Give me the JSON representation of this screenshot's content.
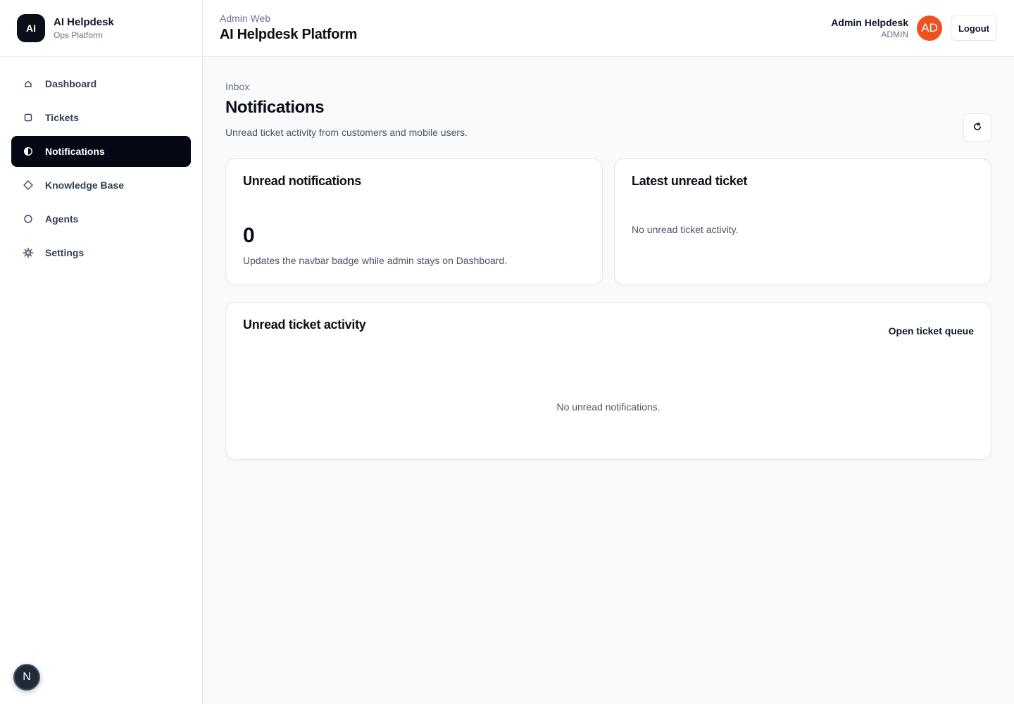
{
  "brand": {
    "logo": "AI",
    "name": "AI Helpdesk",
    "subtitle": "Ops Platform"
  },
  "sidebar": {
    "items": [
      {
        "label": "Dashboard",
        "icon": "home-icon"
      },
      {
        "label": "Tickets",
        "icon": "square-icon"
      },
      {
        "label": "Notifications",
        "icon": "half-circle-icon",
        "active": true
      },
      {
        "label": "Knowledge Base",
        "icon": "diamond-icon"
      },
      {
        "label": "Agents",
        "icon": "circle-icon"
      },
      {
        "label": "Settings",
        "icon": "gear-icon"
      }
    ]
  },
  "header": {
    "eyebrow": "Admin Web",
    "title": "AI Helpdesk Platform",
    "user_name": "Admin Helpdesk",
    "user_role": "ADMIN",
    "avatar_initials": "AD",
    "logout_label": "Logout"
  },
  "page": {
    "eyebrow": "Inbox",
    "title": "Notifications",
    "description": "Unread ticket activity from customers and mobile users."
  },
  "cards": {
    "unread": {
      "title": "Unread notifications",
      "count": "0",
      "note": "Updates the navbar badge while admin stays on Dashboard."
    },
    "latest": {
      "title": "Latest unread ticket",
      "empty": "No unread ticket activity."
    },
    "activity": {
      "title": "Unread ticket activity",
      "link": "Open ticket queue",
      "empty": "No unread notifications."
    }
  },
  "fab": {
    "label": "N"
  },
  "colors": {
    "accent_dark": "#050814",
    "avatar": "#f0521f"
  }
}
